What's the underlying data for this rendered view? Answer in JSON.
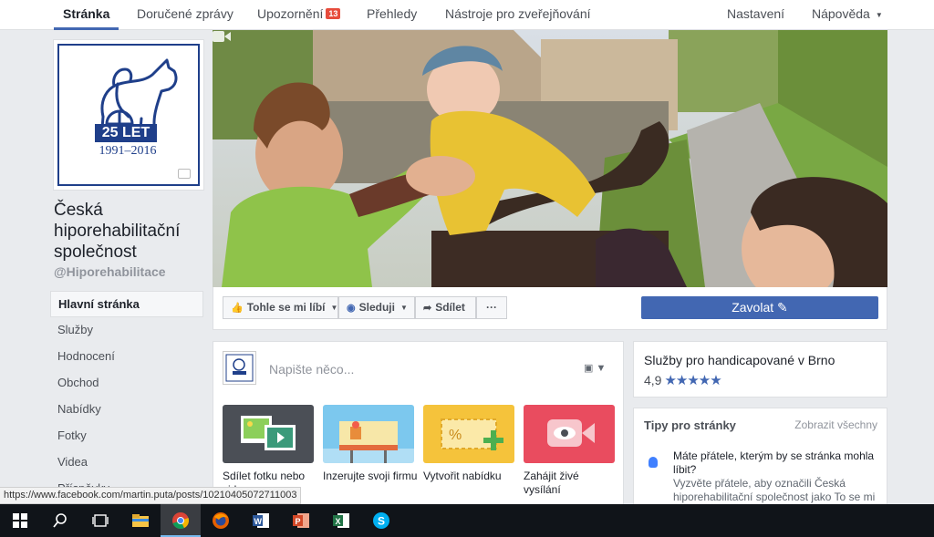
{
  "topnav": {
    "tabs": [
      {
        "label": "Stránka"
      },
      {
        "label": "Doručené zprávy"
      },
      {
        "label": "Upozornění",
        "badge": "13"
      },
      {
        "label": "Přehledy"
      },
      {
        "label": "Nástroje pro zveřejňování"
      }
    ],
    "settings": "Nastavení",
    "help": "Nápověda"
  },
  "profile": {
    "logo_text": "25 LET",
    "logo_years": "1991–2016",
    "name": "Česká hiporehabilitační společnost",
    "handle": "@Hiporehabilitace"
  },
  "leftnav": {
    "items": [
      {
        "label": "Hlavní stránka"
      },
      {
        "label": "Služby"
      },
      {
        "label": "Hodnocení"
      },
      {
        "label": "Obchod"
      },
      {
        "label": "Nabídky"
      },
      {
        "label": "Fotky"
      },
      {
        "label": "Videa"
      },
      {
        "label": "Příspěvky"
      }
    ]
  },
  "actions": {
    "like": "Tohle se mi líbí",
    "follow": "Sleduji",
    "share": "Sdílet",
    "more": "···",
    "call": "Zavolat"
  },
  "composer": {
    "placeholder": "Napište něco...",
    "tiles": [
      {
        "label": "Sdílet fotku nebo video"
      },
      {
        "label": "Inzerujte svoji firmu"
      },
      {
        "label": "Vytvořit nabídku"
      },
      {
        "label": "Zahájit živé vysílání"
      }
    ]
  },
  "about": {
    "category": "Služby pro handicapované v Brno",
    "rating": "4,9",
    "stars": "★★★★★"
  },
  "tips": {
    "title": "Tipy pro stránky",
    "see_all": "Zobrazit všechny",
    "question": "Máte přátele, kterým by se stránka mohla líbit?",
    "description": "Vyzvěte přátele, aby označili Česká hiporehabilitační společnost jako To se mi líbí"
  },
  "status_url": "https://www.facebook.com/martin.puta/posts/10210405072711003",
  "taskbar": {
    "icons": [
      "windows-start",
      "search",
      "task-view",
      "file-explorer",
      "chrome",
      "firefox",
      "word",
      "powerpoint",
      "excel",
      "skype"
    ],
    "active": "chrome"
  },
  "colors": {
    "brand": "#4267b2",
    "logo_blue": "#1f3f8a",
    "badge_red": "#e74c3c"
  }
}
